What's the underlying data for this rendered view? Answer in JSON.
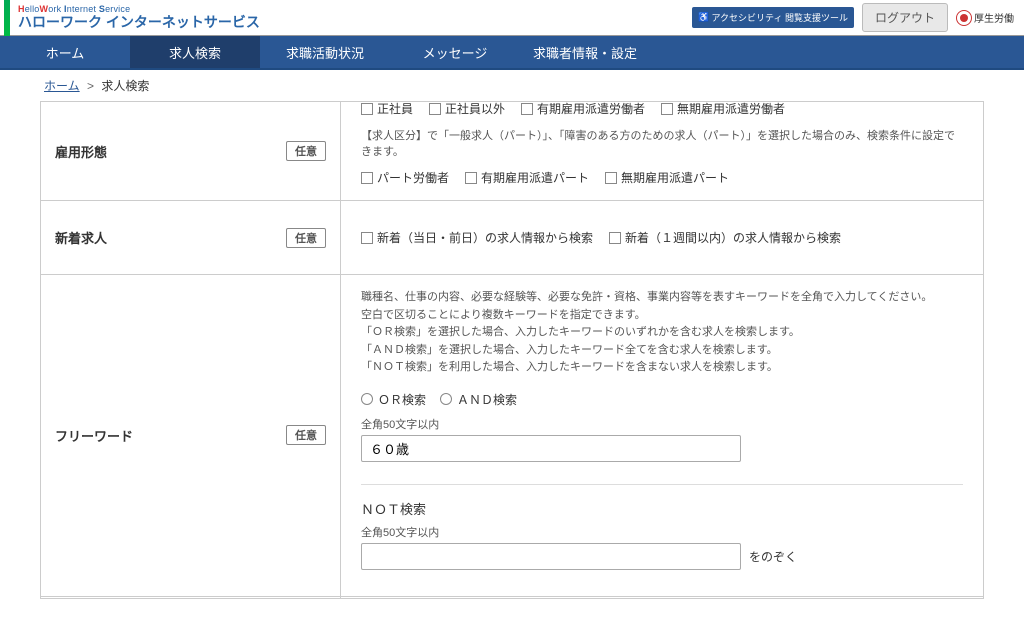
{
  "brand": {
    "en_prefix1": "H",
    "en_rest1": "ello",
    "en_prefix2": "W",
    "en_rest2": "ork ",
    "en_prefix3": "I",
    "en_rest3": "nternet ",
    "en_prefix4": "S",
    "en_rest4": "ervice",
    "jp": "ハローワーク インターネットサービス"
  },
  "topbar": {
    "accessibility_label": "アクセシビリティ 閲覧支援ツール",
    "logout_label": "ログアウト",
    "ministry_label": "厚生労働"
  },
  "nav": {
    "home": "ホーム",
    "search": "求人検索",
    "activity": "求職活動状況",
    "message": "メッセージ",
    "seeker": "求職者情報・設定"
  },
  "breadcrumb": {
    "home": "ホーム",
    "sep": ">",
    "current": "求人検索"
  },
  "tags": {
    "optional": "任意"
  },
  "rows": {
    "employment": {
      "label": "雇用形態",
      "chk_fulltime": "正社員",
      "chk_other_fulltime": "正社員以外",
      "chk_fixed_dispatch": "有期雇用派遣労働者",
      "chk_nofixed_dispatch": "無期雇用派遣労働者",
      "note": "【求人区分】で「一般求人（パート）」、「障害のある方のための求人（パート）」を選択した場合のみ、検索条件に設定できます。",
      "chk_part": "パート労働者",
      "chk_fixed_part_dispatch": "有期雇用派遣パート",
      "chk_nofixed_part_dispatch": "無期雇用派遣パート"
    },
    "new": {
      "label": "新着求人",
      "chk_today": "新着（当日・前日）の求人情報から検索",
      "chk_week": "新着（１週間以内）の求人情報から検索"
    },
    "freeword": {
      "label": "フリーワード",
      "help1": "職種名、仕事の内容、必要な経験等、必要な免許・資格、事業内容等を表すキーワードを全角で入力してください。",
      "help2": "空白で区切ることにより複数キーワードを指定できます。",
      "help3": "「ＯＲ検索」を選択した場合、入力したキーワードのいずれかを含む求人を検索します。",
      "help4": "「ＡＮＤ検索」を選択した場合、入力したキーワード全てを含む求人を検索します。",
      "help5": "「ＮＯＴ検索」を利用した場合、入力したキーワードを含まない求人を検索します。",
      "radio_or": "ＯＲ検索",
      "radio_and": "ＡＮＤ検索",
      "limit_label": "全角50文字以内",
      "input_value": "６０歳",
      "not_head": "ＮＯＴ検索",
      "not_limit_label": "全角50文字以内",
      "not_after": "をのぞく"
    }
  }
}
